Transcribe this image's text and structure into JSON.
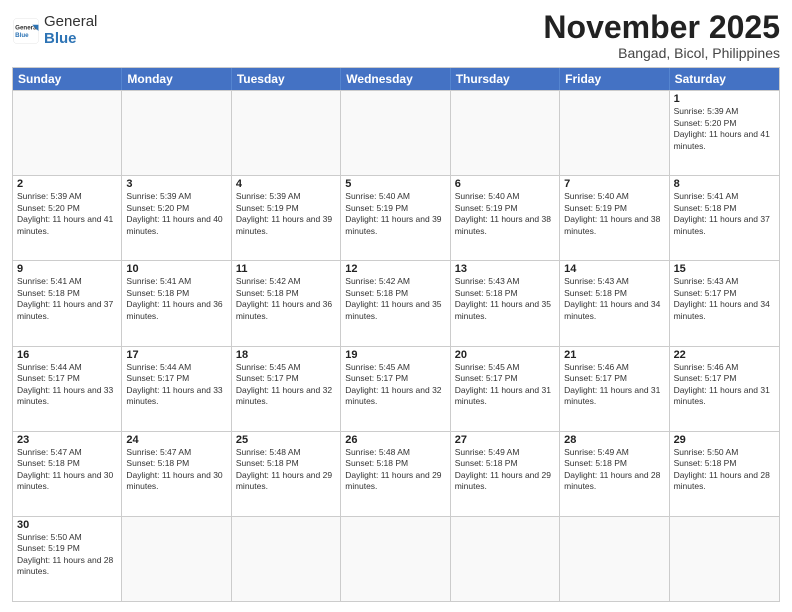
{
  "header": {
    "logo_general": "General",
    "logo_blue": "Blue",
    "month_title": "November 2025",
    "subtitle": "Bangad, Bicol, Philippines"
  },
  "days_of_week": [
    "Sunday",
    "Monday",
    "Tuesday",
    "Wednesday",
    "Thursday",
    "Friday",
    "Saturday"
  ],
  "weeks": [
    [
      {
        "day": "",
        "empty": true
      },
      {
        "day": "",
        "empty": true
      },
      {
        "day": "",
        "empty": true
      },
      {
        "day": "",
        "empty": true
      },
      {
        "day": "",
        "empty": true
      },
      {
        "day": "",
        "empty": true
      },
      {
        "day": "1",
        "sunrise": "5:39 AM",
        "sunset": "5:20 PM",
        "daylight": "11 hours and 41 minutes."
      }
    ],
    [
      {
        "day": "2",
        "sunrise": "5:39 AM",
        "sunset": "5:20 PM",
        "daylight": "11 hours and 41 minutes."
      },
      {
        "day": "3",
        "sunrise": "5:39 AM",
        "sunset": "5:20 PM",
        "daylight": "11 hours and 40 minutes."
      },
      {
        "day": "4",
        "sunrise": "5:39 AM",
        "sunset": "5:19 PM",
        "daylight": "11 hours and 39 minutes."
      },
      {
        "day": "5",
        "sunrise": "5:40 AM",
        "sunset": "5:19 PM",
        "daylight": "11 hours and 39 minutes."
      },
      {
        "day": "6",
        "sunrise": "5:40 AM",
        "sunset": "5:19 PM",
        "daylight": "11 hours and 38 minutes."
      },
      {
        "day": "7",
        "sunrise": "5:40 AM",
        "sunset": "5:19 PM",
        "daylight": "11 hours and 38 minutes."
      },
      {
        "day": "8",
        "sunrise": "5:41 AM",
        "sunset": "5:18 PM",
        "daylight": "11 hours and 37 minutes."
      }
    ],
    [
      {
        "day": "9",
        "sunrise": "5:41 AM",
        "sunset": "5:18 PM",
        "daylight": "11 hours and 37 minutes."
      },
      {
        "day": "10",
        "sunrise": "5:41 AM",
        "sunset": "5:18 PM",
        "daylight": "11 hours and 36 minutes."
      },
      {
        "day": "11",
        "sunrise": "5:42 AM",
        "sunset": "5:18 PM",
        "daylight": "11 hours and 36 minutes."
      },
      {
        "day": "12",
        "sunrise": "5:42 AM",
        "sunset": "5:18 PM",
        "daylight": "11 hours and 35 minutes."
      },
      {
        "day": "13",
        "sunrise": "5:43 AM",
        "sunset": "5:18 PM",
        "daylight": "11 hours and 35 minutes."
      },
      {
        "day": "14",
        "sunrise": "5:43 AM",
        "sunset": "5:18 PM",
        "daylight": "11 hours and 34 minutes."
      },
      {
        "day": "15",
        "sunrise": "5:43 AM",
        "sunset": "5:17 PM",
        "daylight": "11 hours and 34 minutes."
      }
    ],
    [
      {
        "day": "16",
        "sunrise": "5:44 AM",
        "sunset": "5:17 PM",
        "daylight": "11 hours and 33 minutes."
      },
      {
        "day": "17",
        "sunrise": "5:44 AM",
        "sunset": "5:17 PM",
        "daylight": "11 hours and 33 minutes."
      },
      {
        "day": "18",
        "sunrise": "5:45 AM",
        "sunset": "5:17 PM",
        "daylight": "11 hours and 32 minutes."
      },
      {
        "day": "19",
        "sunrise": "5:45 AM",
        "sunset": "5:17 PM",
        "daylight": "11 hours and 32 minutes."
      },
      {
        "day": "20",
        "sunrise": "5:45 AM",
        "sunset": "5:17 PM",
        "daylight": "11 hours and 31 minutes."
      },
      {
        "day": "21",
        "sunrise": "5:46 AM",
        "sunset": "5:17 PM",
        "daylight": "11 hours and 31 minutes."
      },
      {
        "day": "22",
        "sunrise": "5:46 AM",
        "sunset": "5:17 PM",
        "daylight": "11 hours and 31 minutes."
      }
    ],
    [
      {
        "day": "23",
        "sunrise": "5:47 AM",
        "sunset": "5:18 PM",
        "daylight": "11 hours and 30 minutes."
      },
      {
        "day": "24",
        "sunrise": "5:47 AM",
        "sunset": "5:18 PM",
        "daylight": "11 hours and 30 minutes."
      },
      {
        "day": "25",
        "sunrise": "5:48 AM",
        "sunset": "5:18 PM",
        "daylight": "11 hours and 29 minutes."
      },
      {
        "day": "26",
        "sunrise": "5:48 AM",
        "sunset": "5:18 PM",
        "daylight": "11 hours and 29 minutes."
      },
      {
        "day": "27",
        "sunrise": "5:49 AM",
        "sunset": "5:18 PM",
        "daylight": "11 hours and 29 minutes."
      },
      {
        "day": "28",
        "sunrise": "5:49 AM",
        "sunset": "5:18 PM",
        "daylight": "11 hours and 28 minutes."
      },
      {
        "day": "29",
        "sunrise": "5:50 AM",
        "sunset": "5:18 PM",
        "daylight": "11 hours and 28 minutes."
      }
    ],
    [
      {
        "day": "30",
        "sunrise": "5:50 AM",
        "sunset": "5:19 PM",
        "daylight": "11 hours and 28 minutes."
      },
      {
        "day": "",
        "empty": true
      },
      {
        "day": "",
        "empty": true
      },
      {
        "day": "",
        "empty": true
      },
      {
        "day": "",
        "empty": true
      },
      {
        "day": "",
        "empty": true
      },
      {
        "day": "",
        "empty": true
      }
    ]
  ]
}
